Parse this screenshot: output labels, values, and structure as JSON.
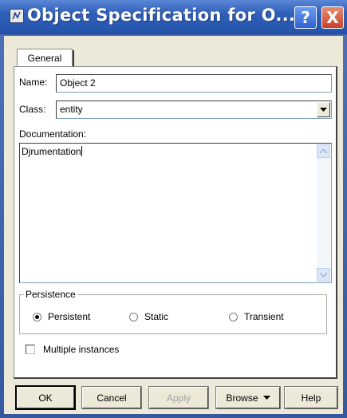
{
  "window": {
    "title": "Object Specification for O...",
    "help_label": "?",
    "close_label": "X"
  },
  "tabs": [
    {
      "label": "General",
      "active": true
    }
  ],
  "form": {
    "name_label": "Name:",
    "name_value": "Object 2",
    "class_label": "Class:",
    "class_value": "entity",
    "documentation_label": "Documentation:",
    "documentation_value": "Djrumentation"
  },
  "persistence": {
    "title": "Persistence",
    "options": [
      {
        "label": "Persistent",
        "selected": true
      },
      {
        "label": "Static",
        "selected": false
      },
      {
        "label": "Transient",
        "selected": false
      }
    ]
  },
  "multiple_instances": {
    "label": "Multiple instances",
    "checked": false
  },
  "buttons": {
    "ok": "OK",
    "cancel": "Cancel",
    "apply": "Apply",
    "browse": "Browse",
    "help": "Help"
  },
  "colors": {
    "titlebar": "#2554ab",
    "dialog_bg": "#ece9d8",
    "close_button": "#c8412a"
  },
  "icons": [
    "window-icon",
    "help-icon",
    "close-icon",
    "dropdown-arrow-icon",
    "scroll-up-icon",
    "scroll-down-icon",
    "browse-arrow-icon"
  ]
}
